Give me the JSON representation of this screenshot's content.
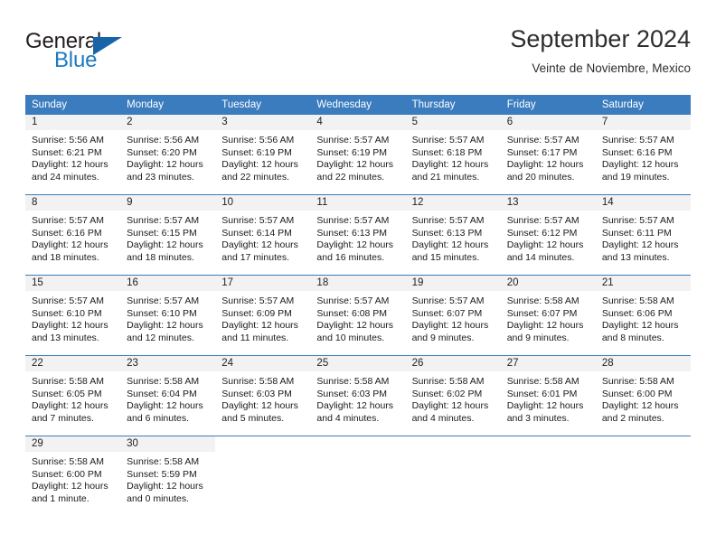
{
  "brand": {
    "word_one": "General",
    "word_two": "Blue",
    "triangle_icon": "triangle-icon",
    "color_dark": "#231f20",
    "color_blue": "#1c7ac0"
  },
  "header": {
    "title": "September 2024",
    "subtitle": "Veinte de Noviembre, Mexico"
  },
  "theme": {
    "header_row_bg": "#3b7cbf",
    "daynum_bg": "#f2f2f2",
    "text": "#1a1a1a"
  },
  "weekdays": [
    "Sunday",
    "Monday",
    "Tuesday",
    "Wednesday",
    "Thursday",
    "Friday",
    "Saturday"
  ],
  "weeks": [
    [
      {
        "day": "1",
        "sunrise": "Sunrise: 5:56 AM",
        "sunset": "Sunset: 6:21 PM",
        "daylight1": "Daylight: 12 hours",
        "daylight2": "and 24 minutes."
      },
      {
        "day": "2",
        "sunrise": "Sunrise: 5:56 AM",
        "sunset": "Sunset: 6:20 PM",
        "daylight1": "Daylight: 12 hours",
        "daylight2": "and 23 minutes."
      },
      {
        "day": "3",
        "sunrise": "Sunrise: 5:56 AM",
        "sunset": "Sunset: 6:19 PM",
        "daylight1": "Daylight: 12 hours",
        "daylight2": "and 22 minutes."
      },
      {
        "day": "4",
        "sunrise": "Sunrise: 5:57 AM",
        "sunset": "Sunset: 6:19 PM",
        "daylight1": "Daylight: 12 hours",
        "daylight2": "and 22 minutes."
      },
      {
        "day": "5",
        "sunrise": "Sunrise: 5:57 AM",
        "sunset": "Sunset: 6:18 PM",
        "daylight1": "Daylight: 12 hours",
        "daylight2": "and 21 minutes."
      },
      {
        "day": "6",
        "sunrise": "Sunrise: 5:57 AM",
        "sunset": "Sunset: 6:17 PM",
        "daylight1": "Daylight: 12 hours",
        "daylight2": "and 20 minutes."
      },
      {
        "day": "7",
        "sunrise": "Sunrise: 5:57 AM",
        "sunset": "Sunset: 6:16 PM",
        "daylight1": "Daylight: 12 hours",
        "daylight2": "and 19 minutes."
      }
    ],
    [
      {
        "day": "8",
        "sunrise": "Sunrise: 5:57 AM",
        "sunset": "Sunset: 6:16 PM",
        "daylight1": "Daylight: 12 hours",
        "daylight2": "and 18 minutes."
      },
      {
        "day": "9",
        "sunrise": "Sunrise: 5:57 AM",
        "sunset": "Sunset: 6:15 PM",
        "daylight1": "Daylight: 12 hours",
        "daylight2": "and 18 minutes."
      },
      {
        "day": "10",
        "sunrise": "Sunrise: 5:57 AM",
        "sunset": "Sunset: 6:14 PM",
        "daylight1": "Daylight: 12 hours",
        "daylight2": "and 17 minutes."
      },
      {
        "day": "11",
        "sunrise": "Sunrise: 5:57 AM",
        "sunset": "Sunset: 6:13 PM",
        "daylight1": "Daylight: 12 hours",
        "daylight2": "and 16 minutes."
      },
      {
        "day": "12",
        "sunrise": "Sunrise: 5:57 AM",
        "sunset": "Sunset: 6:13 PM",
        "daylight1": "Daylight: 12 hours",
        "daylight2": "and 15 minutes."
      },
      {
        "day": "13",
        "sunrise": "Sunrise: 5:57 AM",
        "sunset": "Sunset: 6:12 PM",
        "daylight1": "Daylight: 12 hours",
        "daylight2": "and 14 minutes."
      },
      {
        "day": "14",
        "sunrise": "Sunrise: 5:57 AM",
        "sunset": "Sunset: 6:11 PM",
        "daylight1": "Daylight: 12 hours",
        "daylight2": "and 13 minutes."
      }
    ],
    [
      {
        "day": "15",
        "sunrise": "Sunrise: 5:57 AM",
        "sunset": "Sunset: 6:10 PM",
        "daylight1": "Daylight: 12 hours",
        "daylight2": "and 13 minutes."
      },
      {
        "day": "16",
        "sunrise": "Sunrise: 5:57 AM",
        "sunset": "Sunset: 6:10 PM",
        "daylight1": "Daylight: 12 hours",
        "daylight2": "and 12 minutes."
      },
      {
        "day": "17",
        "sunrise": "Sunrise: 5:57 AM",
        "sunset": "Sunset: 6:09 PM",
        "daylight1": "Daylight: 12 hours",
        "daylight2": "and 11 minutes."
      },
      {
        "day": "18",
        "sunrise": "Sunrise: 5:57 AM",
        "sunset": "Sunset: 6:08 PM",
        "daylight1": "Daylight: 12 hours",
        "daylight2": "and 10 minutes."
      },
      {
        "day": "19",
        "sunrise": "Sunrise: 5:57 AM",
        "sunset": "Sunset: 6:07 PM",
        "daylight1": "Daylight: 12 hours",
        "daylight2": "and 9 minutes."
      },
      {
        "day": "20",
        "sunrise": "Sunrise: 5:58 AM",
        "sunset": "Sunset: 6:07 PM",
        "daylight1": "Daylight: 12 hours",
        "daylight2": "and 9 minutes."
      },
      {
        "day": "21",
        "sunrise": "Sunrise: 5:58 AM",
        "sunset": "Sunset: 6:06 PM",
        "daylight1": "Daylight: 12 hours",
        "daylight2": "and 8 minutes."
      }
    ],
    [
      {
        "day": "22",
        "sunrise": "Sunrise: 5:58 AM",
        "sunset": "Sunset: 6:05 PM",
        "daylight1": "Daylight: 12 hours",
        "daylight2": "and 7 minutes."
      },
      {
        "day": "23",
        "sunrise": "Sunrise: 5:58 AM",
        "sunset": "Sunset: 6:04 PM",
        "daylight1": "Daylight: 12 hours",
        "daylight2": "and 6 minutes."
      },
      {
        "day": "24",
        "sunrise": "Sunrise: 5:58 AM",
        "sunset": "Sunset: 6:03 PM",
        "daylight1": "Daylight: 12 hours",
        "daylight2": "and 5 minutes."
      },
      {
        "day": "25",
        "sunrise": "Sunrise: 5:58 AM",
        "sunset": "Sunset: 6:03 PM",
        "daylight1": "Daylight: 12 hours",
        "daylight2": "and 4 minutes."
      },
      {
        "day": "26",
        "sunrise": "Sunrise: 5:58 AM",
        "sunset": "Sunset: 6:02 PM",
        "daylight1": "Daylight: 12 hours",
        "daylight2": "and 4 minutes."
      },
      {
        "day": "27",
        "sunrise": "Sunrise: 5:58 AM",
        "sunset": "Sunset: 6:01 PM",
        "daylight1": "Daylight: 12 hours",
        "daylight2": "and 3 minutes."
      },
      {
        "day": "28",
        "sunrise": "Sunrise: 5:58 AM",
        "sunset": "Sunset: 6:00 PM",
        "daylight1": "Daylight: 12 hours",
        "daylight2": "and 2 minutes."
      }
    ],
    [
      {
        "day": "29",
        "sunrise": "Sunrise: 5:58 AM",
        "sunset": "Sunset: 6:00 PM",
        "daylight1": "Daylight: 12 hours",
        "daylight2": "and 1 minute."
      },
      {
        "day": "30",
        "sunrise": "Sunrise: 5:58 AM",
        "sunset": "Sunset: 5:59 PM",
        "daylight1": "Daylight: 12 hours",
        "daylight2": "and 0 minutes."
      },
      {
        "day": "",
        "sunrise": "",
        "sunset": "",
        "daylight1": "",
        "daylight2": ""
      },
      {
        "day": "",
        "sunrise": "",
        "sunset": "",
        "daylight1": "",
        "daylight2": ""
      },
      {
        "day": "",
        "sunrise": "",
        "sunset": "",
        "daylight1": "",
        "daylight2": ""
      },
      {
        "day": "",
        "sunrise": "",
        "sunset": "",
        "daylight1": "",
        "daylight2": ""
      },
      {
        "day": "",
        "sunrise": "",
        "sunset": "",
        "daylight1": "",
        "daylight2": ""
      }
    ]
  ]
}
